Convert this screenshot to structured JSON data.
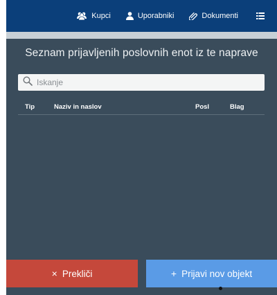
{
  "nav": {
    "items": [
      {
        "label": "Kupci",
        "icon": "users-icon"
      },
      {
        "label": "Uporabniki",
        "icon": "user-icon"
      },
      {
        "label": "Dokumenti",
        "icon": "documents-icon"
      }
    ],
    "menu_icon": "list-menu-icon"
  },
  "panel": {
    "title": "Seznam prijavljenih poslovnih enot iz te naprave",
    "search": {
      "placeholder": "Iskanje",
      "value": "",
      "icon": "search-icon"
    },
    "table": {
      "columns": [
        "Tip",
        "Naziv in naslov",
        "Posl",
        "Blag"
      ],
      "rows": []
    }
  },
  "actions": {
    "cancel": {
      "label": "Prekliči",
      "symbol": "×"
    },
    "add": {
      "label": "Prijavi nov objekt",
      "symbol": "+"
    }
  },
  "colors": {
    "topbar": "#0b3f7a",
    "panel": "#3a4c5b",
    "cancel": "#c5483b",
    "add": "#5a9be6"
  }
}
